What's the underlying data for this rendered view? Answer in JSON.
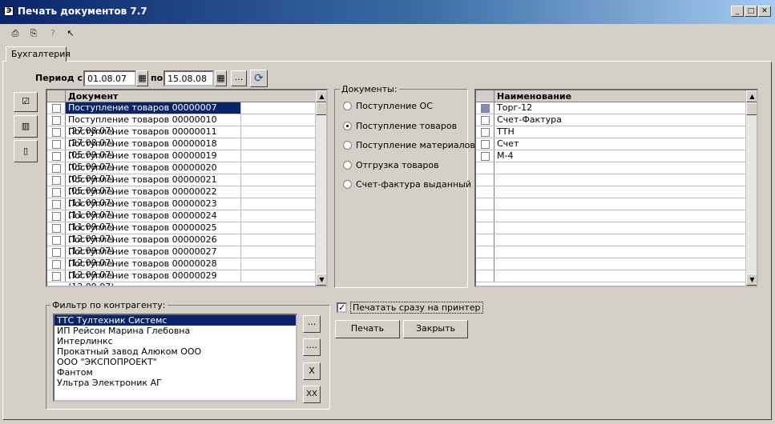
{
  "window": {
    "title": "Печать документов 7.7",
    "icon": "app-icon",
    "controls": [
      "minimize-icon",
      "restore-icon",
      "close-icon"
    ]
  },
  "toolbar": {
    "icons": [
      "print-setup-icon",
      "print-preview-icon",
      "help-icon",
      "context-help-icon"
    ]
  },
  "tab": {
    "label": "Бухгалтерия"
  },
  "period": {
    "label_from": "Период с",
    "from": "01.08.07",
    "label_to": "по",
    "to": "15.08.08",
    "more": "...",
    "refresh_icon": "refresh-icon"
  },
  "documents_grid": {
    "header": "Документ",
    "rows": [
      "Поступление товаров 00000007 (16.08.07)",
      "Поступление товаров 00000010 (27.08.07)",
      "Поступление товаров 00000011 (27.08.07)",
      "Поступление товаров 00000018 (05.09.07)",
      "Поступление товаров 00000019 (05.09.07)",
      "Поступление товаров 00000020 (05.09.07)",
      "Поступление товаров 00000021 (05.09.07)",
      "Поступление товаров 00000022 (11.09.07)",
      "Поступление товаров 00000023 (11.09.07)",
      "Поступление товаров 00000024 (11.09.07)",
      "Поступление товаров 00000025 (12.09.07)",
      "Поступление товаров 00000026 (12.09.07)",
      "Поступление товаров 00000027 (12.09.07)",
      "Поступление товаров 00000028 (12.09.07)",
      "Поступление товаров 00000029 (12.09.07)"
    ]
  },
  "doc_types": {
    "label": "Документы:",
    "options": [
      "Поступление ОС",
      "Поступление товаров",
      "Поступление материалов",
      "Отгрузка товаров",
      "Счет-фактура выданный"
    ],
    "selected": "Поступление товаров"
  },
  "forms_grid": {
    "header": "Наименование",
    "rows": [
      "Торг-12",
      "Счет-Фактура",
      "ТТН",
      "Счет",
      "М-4"
    ]
  },
  "filter": {
    "label": "Фильтр по контрагенту:",
    "items": [
      "ТТС Тултехник Системс",
      "ИП Рейсон Марина Глебовна",
      "Интерлинкс",
      "Прокатный завод Алюком ООО",
      "ООО \"ЭКСПОПРОЕКТ\"",
      "Фантом",
      "Ультра Электроник АГ"
    ],
    "buttons": [
      "...",
      "....",
      "X",
      "XX"
    ]
  },
  "print_direct": {
    "label": "Печатать сразу на принтер",
    "checked": true
  },
  "actions": {
    "print": "Печать",
    "close": "Закрыть"
  }
}
